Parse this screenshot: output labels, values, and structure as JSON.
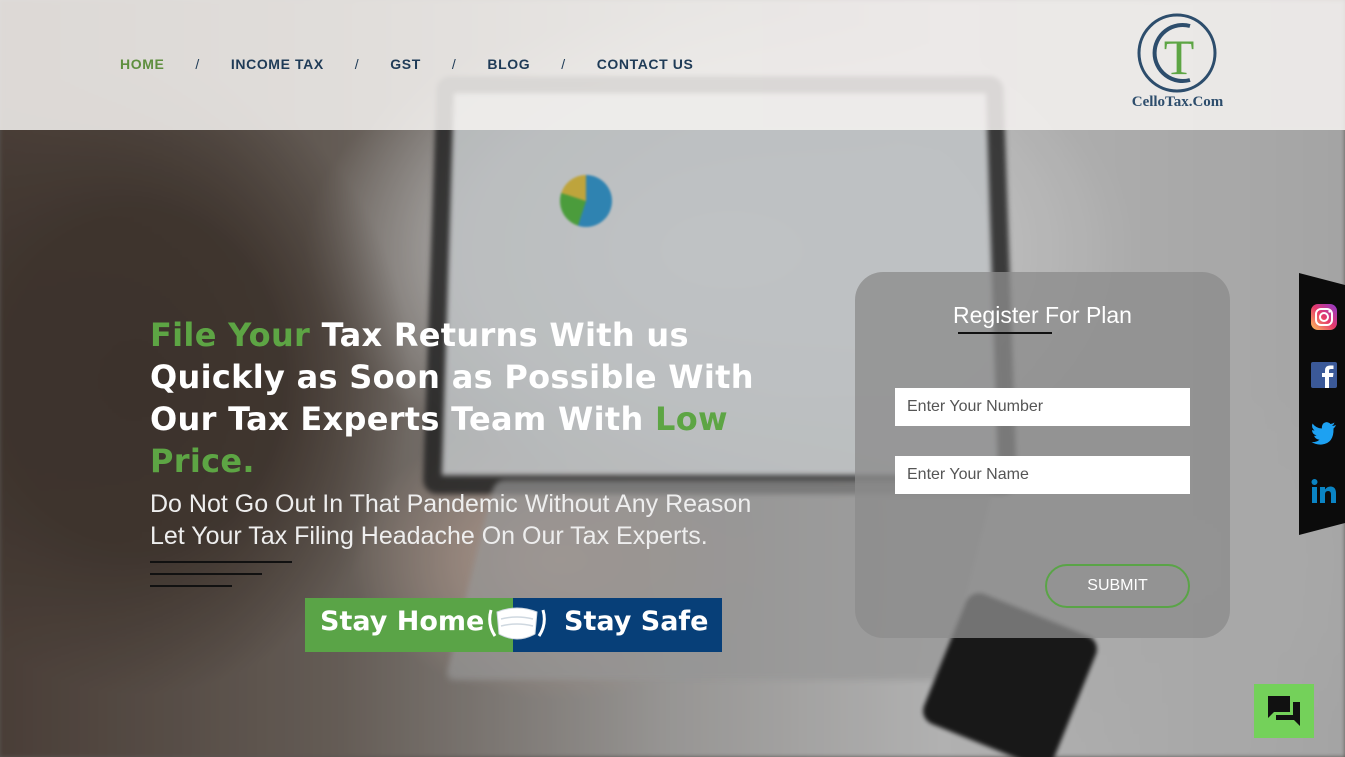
{
  "nav": {
    "items": [
      {
        "label": "HOME",
        "active": true
      },
      {
        "label": "INCOME TAX",
        "active": false
      },
      {
        "label": "GST",
        "active": false
      },
      {
        "label": "BLOG",
        "active": false
      },
      {
        "label": "CONTACT US",
        "active": false
      }
    ],
    "separator": "/"
  },
  "logo": {
    "letter": "T",
    "text": "CelloTax.Com"
  },
  "hero": {
    "headline": {
      "part1_green": "File Your",
      "part2": " Tax Returns With us Quickly as Soon as Possible With Our Tax Experts Team With ",
      "part3_green": "Low Price."
    },
    "subtext_line1": "Do Not Go Out In That Pandemic Without Any Reason",
    "subtext_line2": "Let Your Tax Filing Headache On Our Tax Experts."
  },
  "banner": {
    "left_text": "Stay Home",
    "right_text": "Stay Safe"
  },
  "register": {
    "title": "Register For Plan",
    "number_placeholder": "Enter Your Number",
    "name_placeholder": "Enter Your Name",
    "submit_label": "SUBMIT"
  },
  "social": [
    "instagram-icon",
    "facebook-icon",
    "twitter-icon",
    "linkedin-icon"
  ],
  "colors": {
    "accent_green": "#5da544",
    "nav_blue": "#1f3b57",
    "banner_blue": "#073f78",
    "chat_green": "#74d15a"
  }
}
